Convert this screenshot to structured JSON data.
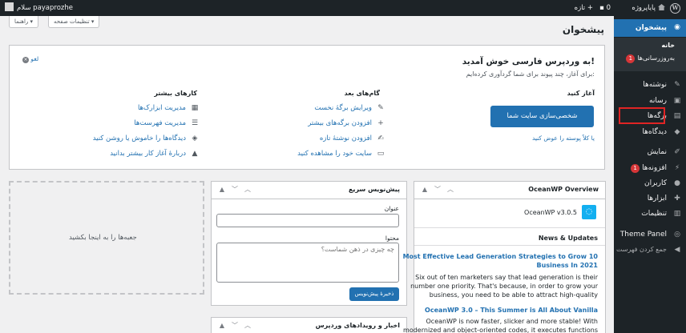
{
  "admin_bar": {
    "site_name": "پایاپروژه",
    "comments_count": "0",
    "new_label": "تازه",
    "howdy": "سلام payaprozhe"
  },
  "screen_options": {
    "screen_options_label": "تنظیمات صفحه",
    "help_label": "راهنما"
  },
  "sidebar": {
    "dashboard": "پیشخوان",
    "home": "خانه",
    "updates": "به‌روزرسانی‌ها",
    "updates_badge": "1",
    "posts": "نوشته‌ها",
    "media": "رسانه",
    "pages": "برگه‌ها",
    "comments": "دیدگاه‌ها",
    "appearance": "نمایش",
    "plugins": "افزونه‌ها",
    "plugins_badge": "1",
    "users": "کاربران",
    "tools": "ابزارها",
    "settings": "تنظیمات",
    "theme_panel": "Theme Panel",
    "collapse": "جمع کردن فهرست"
  },
  "page_title": "پیشخوان",
  "welcome": {
    "dismiss": "لغو",
    "title": "به وردپرس فارسی خوش آمدید!",
    "subtitle": "برای آغاز، چند پیوند برای شما گردآوری کرده‌ایم:",
    "col1_heading": "آغاز کنید",
    "cta_button": "شخصی‌سازی سایت شما",
    "or_link": "یا کلاً پوسته را عوض کنید",
    "col2_heading": "گام‌های بعد",
    "next_steps": [
      "ویرایش برگهٔ نخست",
      "افزودن برگه‌های بیشتر",
      "افزودن نوشتهٔ تازه",
      "سایت خود را مشاهده کنید"
    ],
    "col3_heading": "کارهای بیشتر",
    "more_actions": [
      "مدیریت ابزارک‌ها",
      "مدیریت فهرست‌ها",
      "دیدگاه‌ها را خاموش یا روشن کنید",
      "دربارهٔ آغاز کار بیشتر بدانید"
    ]
  },
  "drop_zone_text": "جعبه‌ها را به اینجا بکشید",
  "quick_draft": {
    "title": "پیش‌نویس سریع",
    "title_label": "عنوان",
    "content_label": "محتوا",
    "content_placeholder": "چه چیزی در ذهن شماست؟",
    "save_button": "ذخیرهٔ پیش‌نویس"
  },
  "news_widget": {
    "title": "اخبار و رویدادهای وردپرس"
  },
  "oceanwp": {
    "title": "OceanWP Overview",
    "version": "OceanWP v3.0.5",
    "news_heading": "News & Updates",
    "article1_title_line1": "Most Effective Lead Generation Strategies to Grow 10",
    "article1_title_line2": "Business In 2021",
    "article1_text": [
      "Six out of ten marketers say that lead generation is their",
      "number one priority. That's because, in order to grow your",
      "business, you need to be able to attract high-quality"
    ],
    "article2_title": "OceanWP 3.0 – This Summer is All About Vanilla",
    "article2_text": [
      "OceanWP is now faster, slicker and more stable! With",
      "modernized and object-oriented codes, it executes functions"
    ]
  }
}
